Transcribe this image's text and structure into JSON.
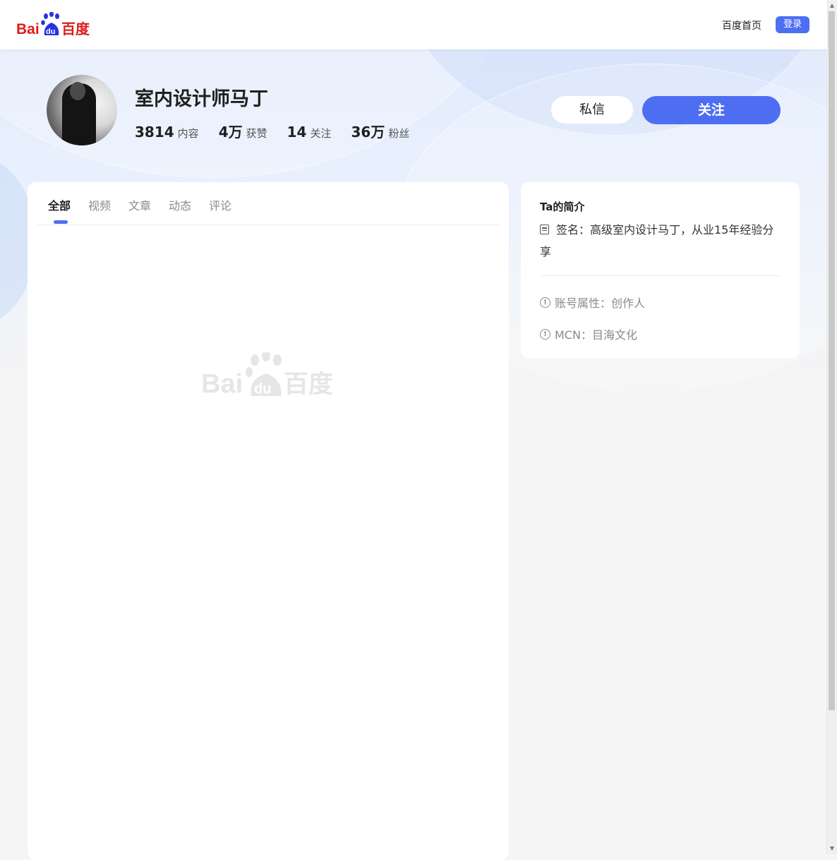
{
  "header": {
    "logo_text_bai": "Bai",
    "logo_text_du": "du",
    "logo_text_cn": "百度",
    "home_link": "百度首页",
    "login_label": "登录",
    "accent_color": "#4e6ef2"
  },
  "profile": {
    "name": "室内设计师马丁",
    "stats": [
      {
        "value": "3814",
        "label": "内容"
      },
      {
        "value": "4万",
        "label": "获赞"
      },
      {
        "value": "14",
        "label": "关注"
      },
      {
        "value": "36万",
        "label": "粉丝"
      }
    ],
    "message_label": "私信",
    "follow_label": "关注"
  },
  "tabs": [
    {
      "label": "全部",
      "active": true
    },
    {
      "label": "视频",
      "active": false
    },
    {
      "label": "文章",
      "active": false
    },
    {
      "label": "动态",
      "active": false
    },
    {
      "label": "评论",
      "active": false
    }
  ],
  "intro": {
    "title": "Ta的简介",
    "signature": "签名：高级室内设计马丁，从业15年经验分享",
    "account_attr": "账号属性：创作人",
    "mcn": "MCN：目海文化"
  },
  "icons": {
    "signature": "document-icon",
    "info": "info-circle-icon"
  }
}
